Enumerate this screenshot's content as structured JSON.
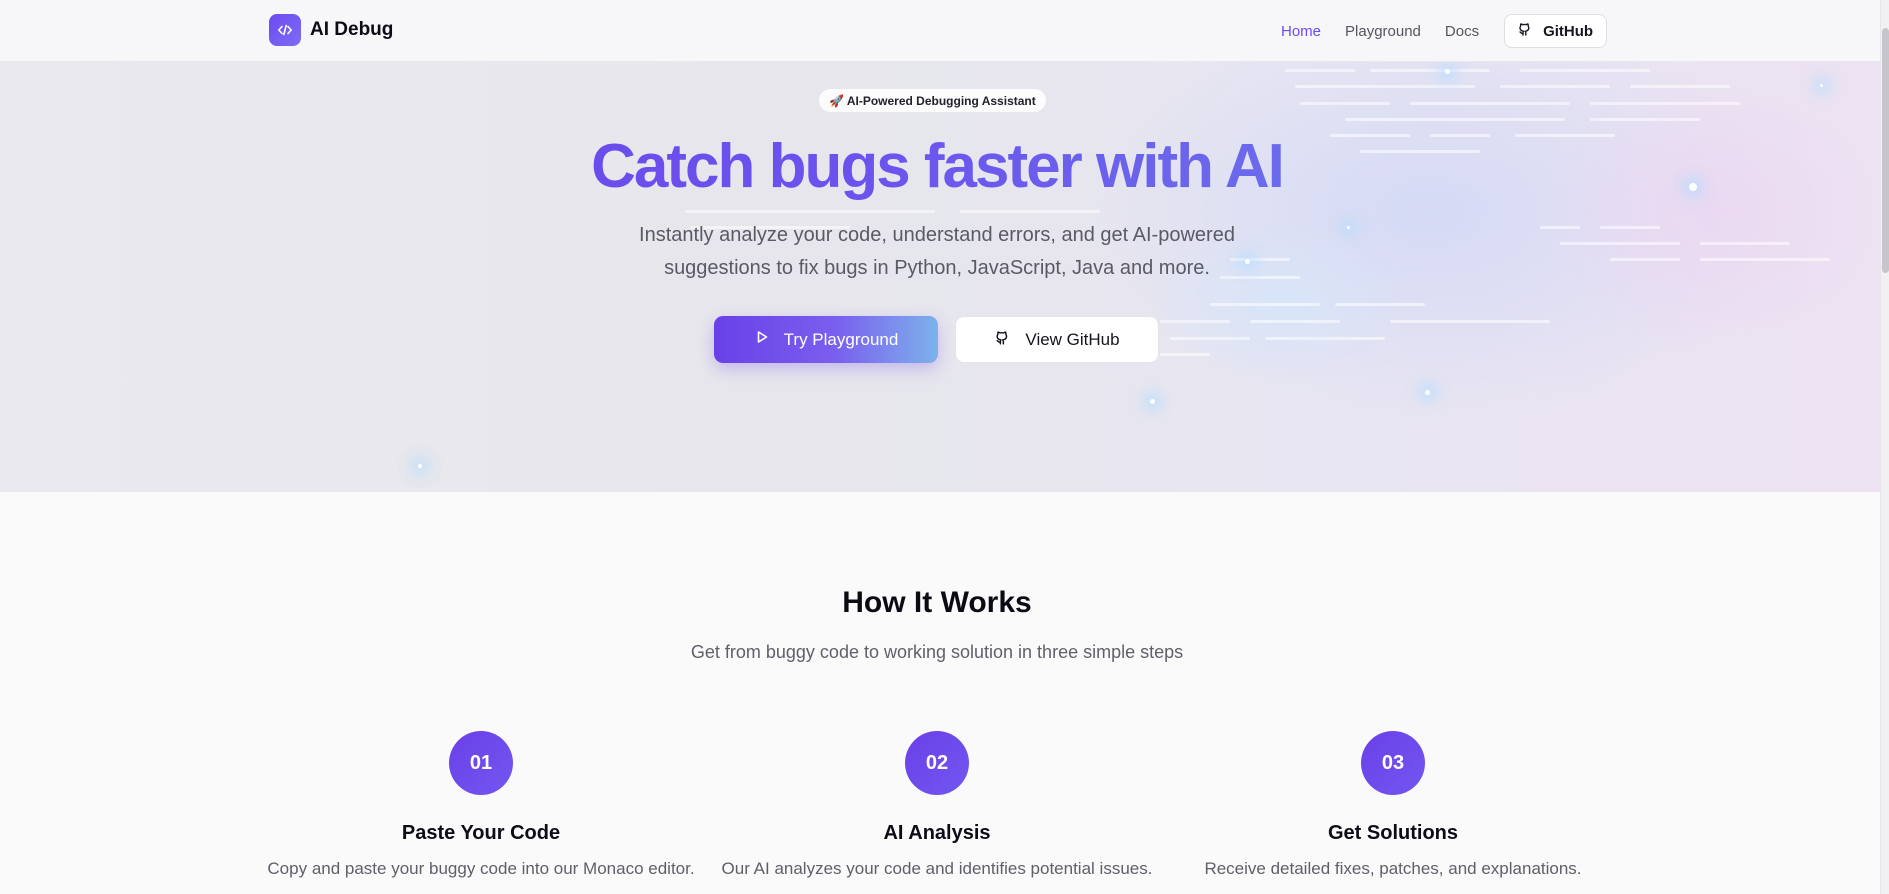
{
  "nav": {
    "brand": "AI Debug",
    "brand_icon": "code-icon",
    "links": [
      {
        "label": "Home",
        "active": true
      },
      {
        "label": "Playground",
        "active": false
      },
      {
        "label": "Docs",
        "active": false
      }
    ],
    "github_label": "GitHub",
    "github_icon": "github-icon"
  },
  "hero": {
    "badge": "🚀 AI-Powered Debugging Assistant",
    "title": "Catch bugs faster with AI",
    "subtitle": "Instantly analyze your code, understand errors, and get AI-powered suggestions to fix bugs in Python, JavaScript, Java and more.",
    "primary_cta": "Try Playground",
    "primary_icon": "play-icon",
    "secondary_cta": "View GitHub",
    "secondary_icon": "github-icon"
  },
  "how": {
    "title": "How It Works",
    "subtitle": "Get from buggy code to working solution in three simple steps",
    "steps": [
      {
        "number": "01",
        "title": "Paste Your Code",
        "description": "Copy and paste your buggy code into our Monaco editor."
      },
      {
        "number": "02",
        "title": "AI Analysis",
        "description": "Our AI analyzes your code and identifies potential issues."
      },
      {
        "number": "03",
        "title": "Get Solutions",
        "description": "Receive detailed fixes, patches, and explanations."
      }
    ]
  },
  "colors": {
    "accent": "#6a40e8",
    "accent_light": "#7db2ec",
    "active_link": "#6d4af0"
  }
}
